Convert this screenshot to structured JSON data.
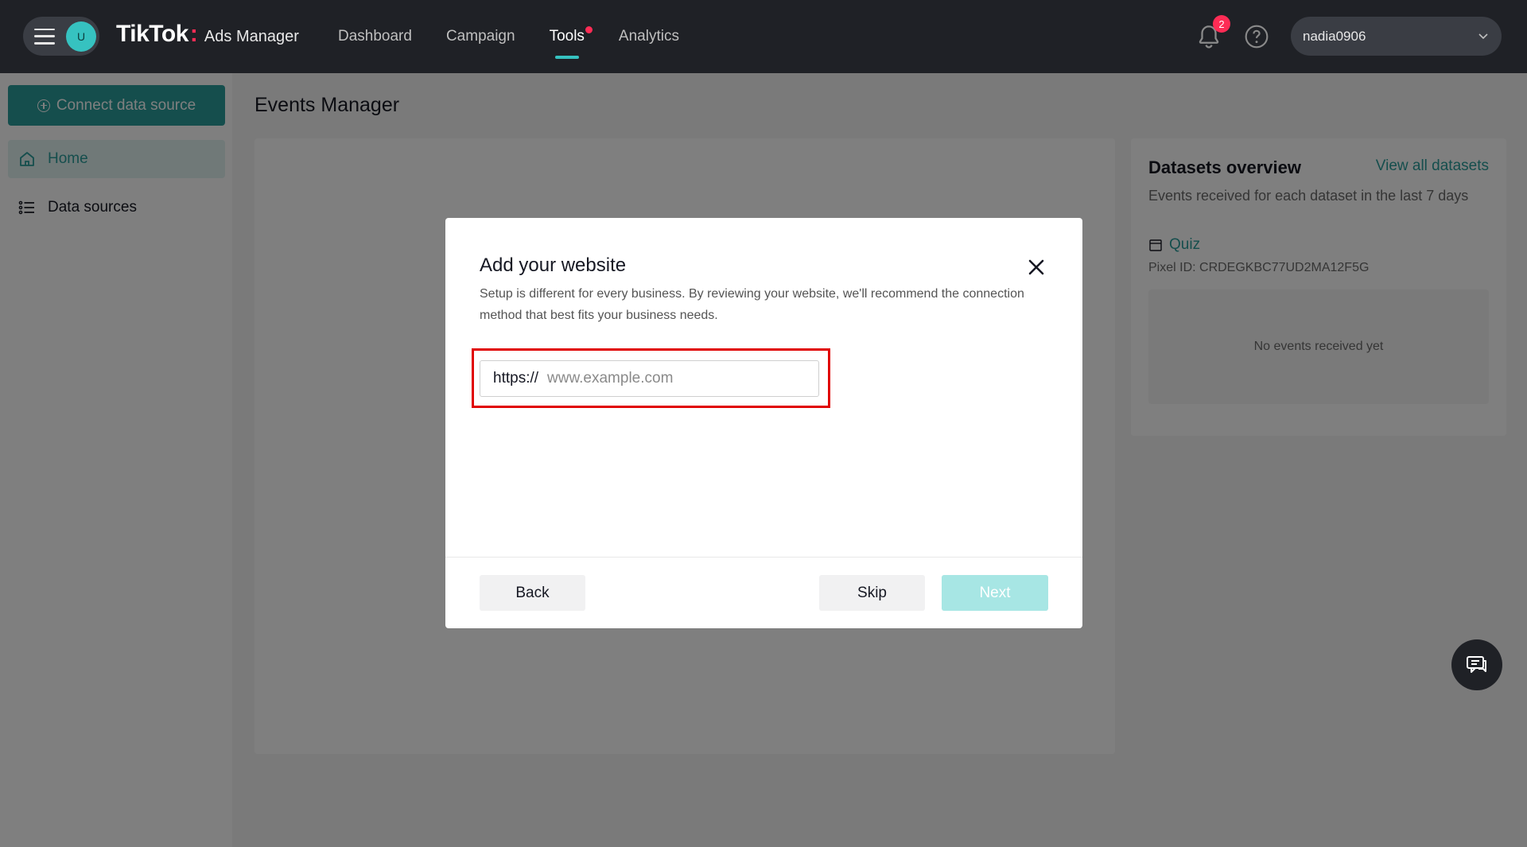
{
  "topbar": {
    "avatar_initial": "U",
    "logo_main": "TikTok",
    "logo_dot": ":",
    "logo_sub": "Ads Manager",
    "nav": [
      "Dashboard",
      "Campaign",
      "Tools",
      "Analytics"
    ],
    "active_nav": "Tools",
    "notification_count": "2",
    "account_name": "nadia0906"
  },
  "sidebar": {
    "connect_label": "Connect data source",
    "items": [
      {
        "label": "Home",
        "icon": "home-icon"
      },
      {
        "label": "Data sources",
        "icon": "list-icon"
      }
    ]
  },
  "main": {
    "page_title": "Events Manager"
  },
  "datasets": {
    "title": "Datasets overview",
    "view_all": "View all datasets",
    "subtitle": "Events received for each dataset in the last 7 days",
    "dataset_name": "Quiz",
    "pixel_id": "Pixel ID: CRDEGKBC77UD2MA12F5G",
    "empty_text": "No events received yet"
  },
  "modal": {
    "title": "Add your website",
    "description": "Setup is different for every business. By reviewing your website, we'll recommend the connection method that best fits your business needs.",
    "url_prefix": "https://",
    "url_placeholder": "www.example.com",
    "url_value": "",
    "back_label": "Back",
    "skip_label": "Skip",
    "next_label": "Next"
  },
  "colors": {
    "accent": "#2a9d9a",
    "accent_light": "#a7e6e4",
    "highlight": "#e00000",
    "badge": "#fe2c55",
    "topbar": "#1f2126"
  }
}
